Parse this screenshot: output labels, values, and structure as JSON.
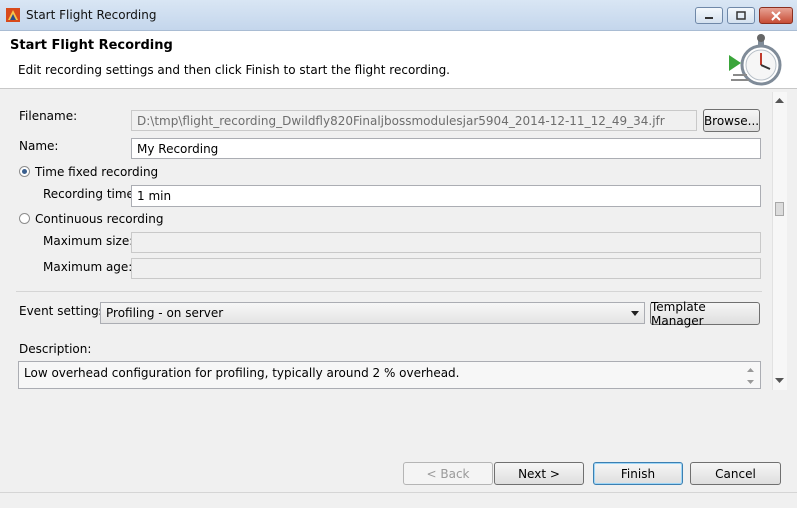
{
  "window": {
    "title": "Start Flight Recording"
  },
  "header": {
    "title": "Start Flight Recording",
    "description": "Edit recording settings and then click Finish to start the flight recording."
  },
  "form": {
    "filename_label": "Filename:",
    "filename_value": "D:\\tmp\\flight_recording_Dwildfly820Finaljbossmodulesjar5904_2014-12-11_12_49_34.jfr",
    "browse_label": "Browse...",
    "name_label": "Name:",
    "name_value": "My Recording",
    "time_fixed_label": "Time fixed recording",
    "recording_time_label": "Recording time:",
    "recording_time_value": "1 min",
    "continuous_label": "Continuous recording",
    "max_size_label": "Maximum size:",
    "max_age_label": "Maximum age:",
    "event_settings_label": "Event settings:",
    "event_settings_value": "Profiling - on server",
    "template_manager_label": "Template Manager",
    "description_label": "Description:",
    "description_value": "Low overhead configuration for profiling, typically around 2 % overhead."
  },
  "buttons": {
    "back": "< Back",
    "next": "Next >",
    "finish": "Finish",
    "cancel": "Cancel"
  }
}
